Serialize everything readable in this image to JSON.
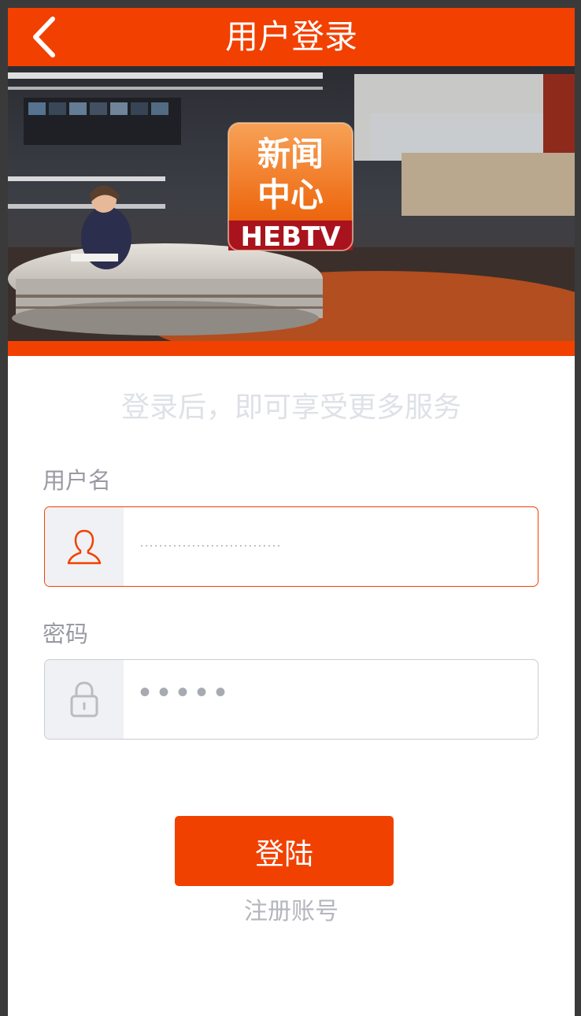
{
  "header": {
    "title": "用户登录",
    "back_icon": "chevron-left-icon",
    "color": "#f14000"
  },
  "banner": {
    "logo_line1": "新闻",
    "logo_line2": "中心",
    "logo_brand": "HEBTV",
    "strip_color": "#f14100"
  },
  "hint": {
    "text": "登录后，即可享受更多服务",
    "color": "#dee1e6"
  },
  "username": {
    "label": "用户名",
    "placeholder": "······························",
    "icon": "user-icon"
  },
  "password": {
    "label": "密码",
    "placeholder": "•••••",
    "icon": "lock-icon"
  },
  "login_button": {
    "label": "登陆",
    "color": "#f14100"
  },
  "register": {
    "label": "注册账号"
  },
  "page_background": "#f3f3f3"
}
